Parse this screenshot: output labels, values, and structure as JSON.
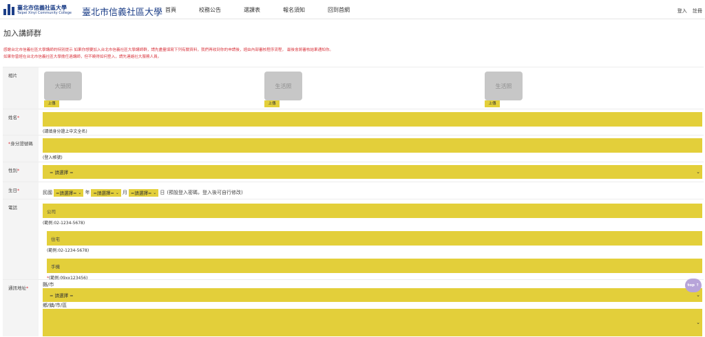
{
  "header": {
    "logo_cn": "臺北市信義社區大學",
    "logo_en": "Taipei Xinyi Community College",
    "title": "臺北市信義社區大學",
    "nav": [
      "首頁",
      "校務公告",
      "選課表",
      "報名須知",
      "回到首網"
    ],
    "login": "登入",
    "register": "註冊"
  },
  "page_title": "加入講師群",
  "notice": {
    "line1": "感謝台北市信義社區大學講師的特別提示 如果你想要加入台北市信義社區大學講師群，請先盡量填寫下列有關資料，我們再收到你的申請後，經由內部審核程序流程， 最後會將審核結果通知你。",
    "line2": "如果你曾經在台北市信義社區大學擔任過講師，但不曉得如何登入，請先連絡社大服務人員。"
  },
  "photo": {
    "label": "相片",
    "items": [
      {
        "text": "大頭照",
        "upload": "上傳"
      },
      {
        "text": "生活照",
        "upload": "上傳"
      },
      {
        "text": "生活照",
        "upload": "上傳"
      }
    ]
  },
  "name": {
    "label": "姓名",
    "required": "*",
    "hint": "(請填身分證上中文全名)"
  },
  "id_number": {
    "required": "*",
    "label": "身分證號碼",
    "hint": "(登入帳號)"
  },
  "gender": {
    "label": "性別",
    "required": "*",
    "selected": "= 請選擇 ="
  },
  "birthday": {
    "label": "生日",
    "required": "*",
    "prefix": "民國",
    "year_sel": "=請選擇=",
    "year": "年",
    "month_sel": "=請選擇=",
    "month": "月",
    "day_sel": "=請選擇=",
    "day": "日",
    "note": "(預設登入密碼，登入後可自行修改)"
  },
  "phone": {
    "label": "電話",
    "office_placeholder": "公司",
    "office_hint": "(範例:02-1234-5678)",
    "home_placeholder": "住宅",
    "home_hint": "(範例:02-1234-5678)",
    "mobile_placeholder": "手機",
    "mobile_required": "*",
    "mobile_hint": "(範例:09xx123456)"
  },
  "address": {
    "label": "通訊地址",
    "required": "*",
    "city_label": "縣/市",
    "city_selected": "= 請選擇 =",
    "district_label": "鄉/鎮/市/區"
  },
  "top_button": "top ↑",
  "colors": {
    "accent": "#e3cf3a",
    "brand": "#1d3f88",
    "notice": "#d9363e"
  }
}
